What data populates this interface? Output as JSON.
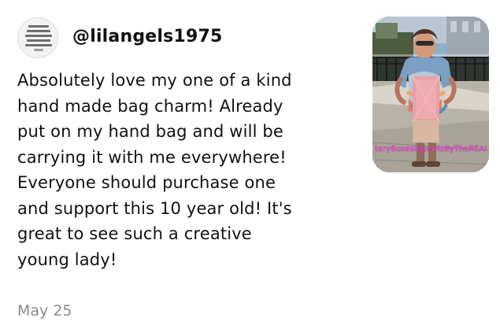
{
  "review": {
    "username": "@lilangels1975",
    "text_lines": [
      "Absolutely love my one of a kind",
      "hand made bag charm! Already",
      "put on my hand bag and will be",
      "carrying it with me everywhere!",
      "Everyone should purchase one",
      "and support this 10 year old! It's",
      "great to see such a creative",
      "young lady!"
    ],
    "date": "May 25",
    "photo_watermark": "teryBoxesByJewlzByTheREAL"
  },
  "colors": {
    "background": "#ffffff",
    "text_primary": "#111111",
    "date_text": "#8a8a8a",
    "watermark": "#ff4fd8"
  },
  "icons": {
    "avatar": "profile-avatar"
  }
}
